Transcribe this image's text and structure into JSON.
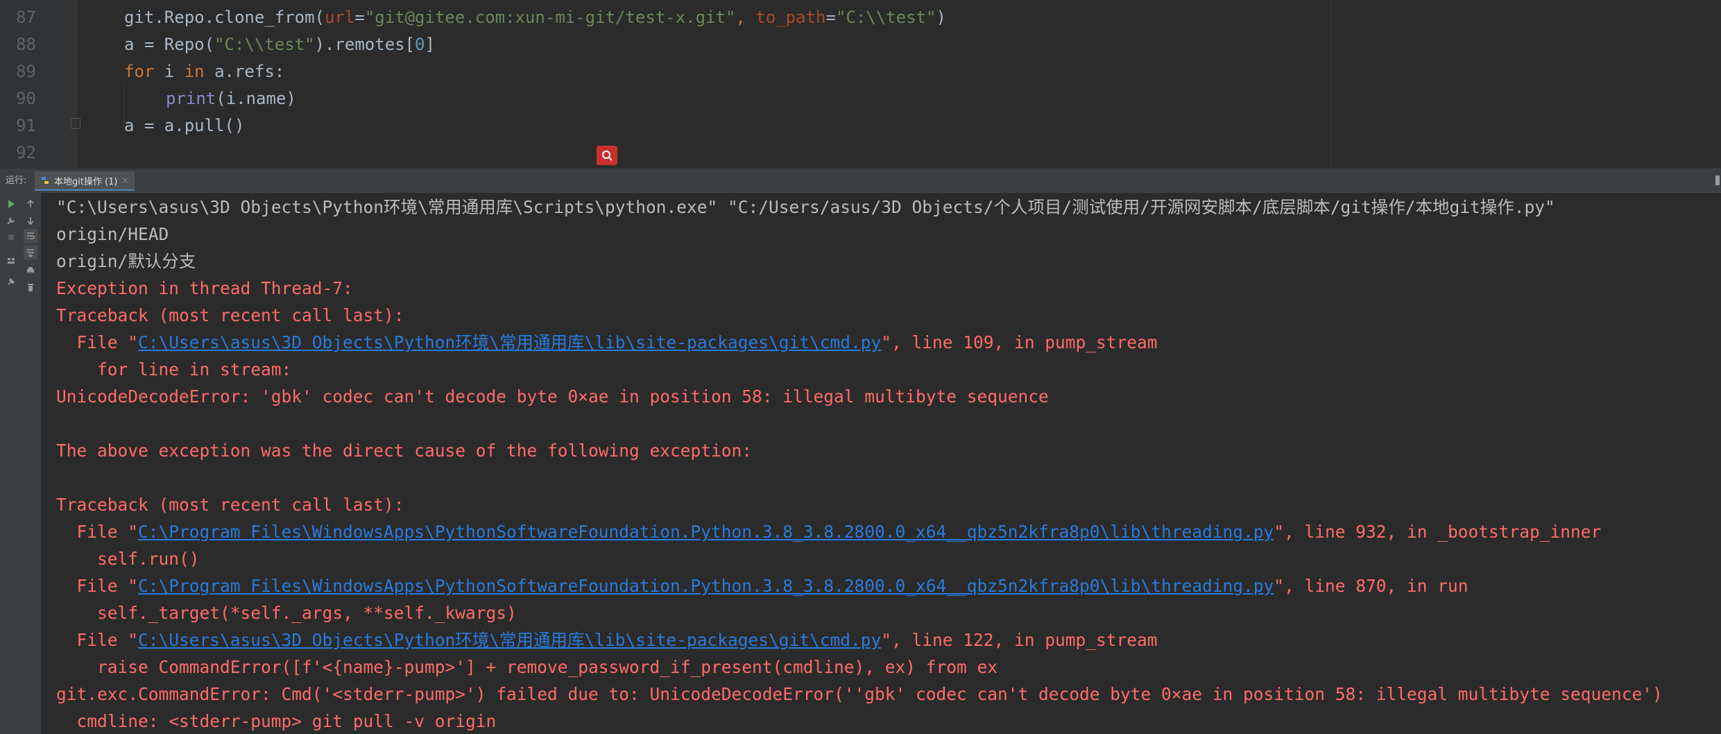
{
  "editor": {
    "line_numbers": [
      "87",
      "88",
      "89",
      "90",
      "91",
      "92"
    ],
    "lines": {
      "l87": {
        "t1": "git.Repo.clone_from(",
        "t2": "url",
        "t3": "=",
        "t4": "\"git@gitee.com:xun-mi-git/test-x.git\"",
        "t5": ", ",
        "t6": "to_path",
        "t7": "=",
        "t8": "\"C:\\\\test\"",
        "t9": ")"
      },
      "l88": {
        "t1": "a = Repo(",
        "t2": "\"C:\\\\test\"",
        "t3": ").remotes[",
        "t4": "0",
        "t5": "]"
      },
      "l89": {
        "t1": "for",
        "t2": " i ",
        "t3": "in",
        "t4": " a.refs:"
      },
      "l90": {
        "t1": "print",
        "t2": "(i.name)"
      },
      "l91": {
        "t1": "a = a.pull()"
      }
    }
  },
  "run_panel": {
    "label": "运行:",
    "tab_label": "本地git操作 (1)",
    "tab_close": "×"
  },
  "console": {
    "c1": "\"C:\\Users\\asus\\3D Objects\\Python环境\\常用通用库\\Scripts\\python.exe\" \"C:/Users/asus/3D Objects/个人项目/测试使用/开源网安脚本/底层脚本/git操作/本地git操作.py\"",
    "c2": "origin/HEAD",
    "c3": "origin/默认分支",
    "c4": "Exception in thread Thread-7:",
    "c5": "Traceback (most recent call last):",
    "c6": {
      "pre": "  File \"",
      "link": "C:\\Users\\asus\\3D Objects\\Python环境\\常用通用库\\lib\\site-packages\\git\\cmd.py",
      "post": "\", line 109, in pump_stream"
    },
    "c7": "    for line in stream:",
    "c8": "UnicodeDecodeError: 'gbk' codec can't decode byte 0×ae in position 58: illegal multibyte sequence",
    "c9": "The above exception was the direct cause of the following exception:",
    "c10": "Traceback (most recent call last):",
    "c11": {
      "pre": "  File \"",
      "link": "C:\\Program Files\\WindowsApps\\PythonSoftwareFoundation.Python.3.8_3.8.2800.0_x64__qbz5n2kfra8p0\\lib\\threading.py",
      "post": "\", line 932, in _bootstrap_inner"
    },
    "c12": "    self.run()",
    "c13": {
      "pre": "  File \"",
      "link": "C:\\Program Files\\WindowsApps\\PythonSoftwareFoundation.Python.3.8_3.8.2800.0_x64__qbz5n2kfra8p0\\lib\\threading.py",
      "post": "\", line 870, in run"
    },
    "c14": "    self._target(*self._args, **self._kwargs)",
    "c15": {
      "pre": "  File \"",
      "link": "C:\\Users\\asus\\3D Objects\\Python环境\\常用通用库\\lib\\site-packages\\git\\cmd.py",
      "post": "\", line 122, in pump_stream"
    },
    "c16": "    raise CommandError([f'<{name}-pump>'] + remove_password_if_present(cmdline), ex) from ex",
    "c17": "git.exc.CommandError: Cmd('<stderr-pump>') failed due to: UnicodeDecodeError(''gbk' codec can't decode byte 0×ae in position 58: illegal multibyte sequence')",
    "c18": "  cmdline: <stderr-pump> git pull -v origin"
  },
  "colors": {
    "editor_bg": "#2b2b2b",
    "gutter_bg": "#313335",
    "panel_bg": "#3c3f41",
    "keyword": "#cc7832",
    "string": "#6a8759",
    "param": "#aa4926",
    "number": "#6897bb",
    "builtin": "#8888c6",
    "error_text": "#ff6b68",
    "link": "#287bde",
    "console_text": "#bbbbbb",
    "inspect_badge": "#c9302c"
  },
  "icons": {
    "inspect_badge": "search-icon",
    "toolbar": [
      "run-icon",
      "wrench-icon",
      "stop-icon",
      "layout-icon",
      "pin-icon",
      "scroll-up-icon",
      "scroll-down-icon",
      "soft-wrap-icon",
      "scroll-to-end-icon",
      "print-icon",
      "trash-icon"
    ]
  }
}
